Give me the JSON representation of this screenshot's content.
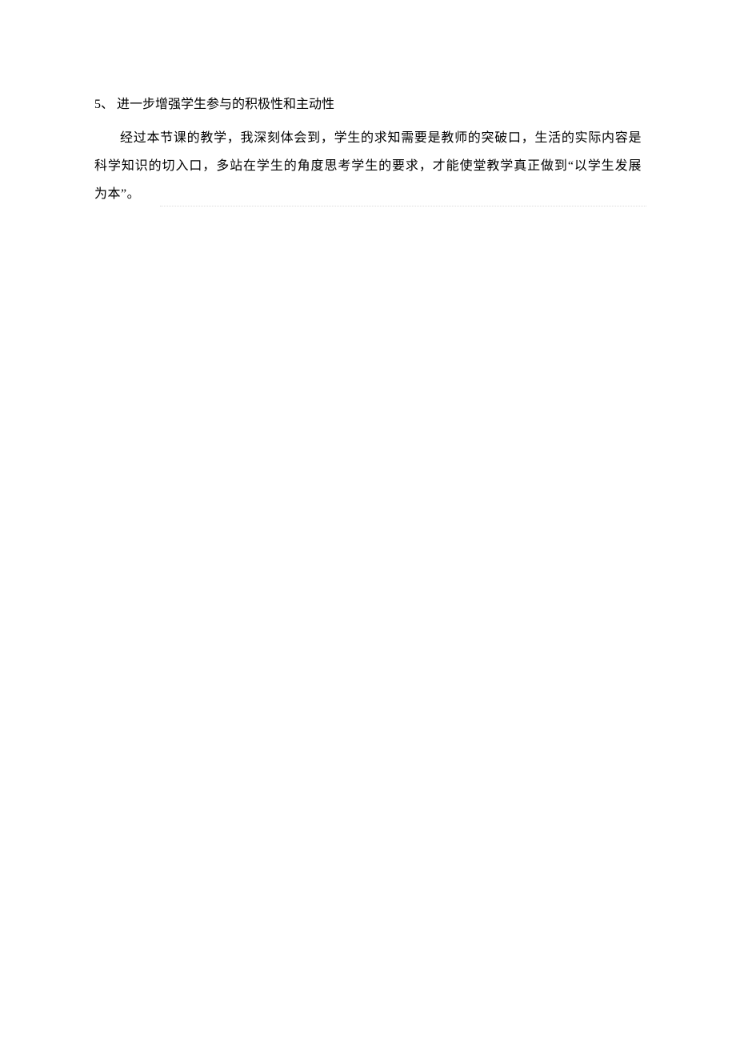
{
  "item": {
    "number": "5、",
    "text": "进一步增强学生参与的积极性和主动性"
  },
  "paragraph": "经过本节课的教学，我深刻体会到，学生的求知需要是教师的突破口，生活的实际内容是科学知识的切入口，多站在学生的角度思考学生的要求，才能使堂教学真正做到“以学生发展为本”。"
}
